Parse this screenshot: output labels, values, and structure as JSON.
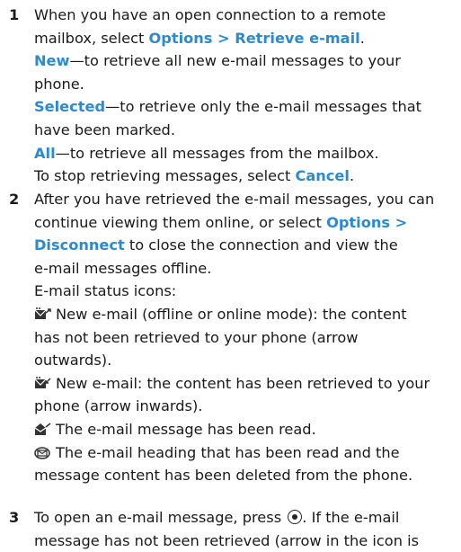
{
  "step1": {
    "number": "1",
    "line1": "When you have an open connection to a remote",
    "line2_text": "mailbox, select ",
    "line2_kw": "Options > Retrieve e-mail",
    "line2_end": ".",
    "new_kw": "New",
    "new_text": "—to retrieve all new e-mail messages to your",
    "new_text2": "phone.",
    "selected_kw": "Selected",
    "selected_text": "—to retrieve only the e-mail messages that",
    "selected_text2": "have been marked.",
    "all_kw": "All",
    "all_text": "—to retrieve all messages from the mailbox.",
    "stop_text": "To stop retrieving messages, select ",
    "stop_kw": "Cancel",
    "stop_end": "."
  },
  "step2": {
    "number": "2",
    "line1": "After you have retrieved the e-mail messages, you can",
    "line2_text": "continue viewing them online, or select ",
    "line2_kw": "Options >",
    "line3_kw": "Disconnect",
    "line3_text": " to close the connection and view the",
    "line4": "e-mail messages offline.",
    "icons_heading": "E-mail status icons:",
    "icons": [
      {
        "icon": "new-email-not-retrieved-icon",
        "text1": "New e-mail (offline or online mode): the content",
        "text2": "has not been retrieved to your phone (arrow",
        "text3": "outwards)."
      },
      {
        "icon": "new-email-retrieved-icon",
        "text1": "New e-mail: the content has been retrieved to your",
        "text2": "phone (arrow inwards)."
      },
      {
        "icon": "read-email-icon",
        "text1": "The e-mail message has been read."
      },
      {
        "icon": "deleted-content-icon",
        "text1": "The e-mail heading that has been read and the",
        "text2": "message content has been deleted from the phone."
      }
    ]
  },
  "step3": {
    "number": "3",
    "line1_a": "To open an e-mail message, press ",
    "line1_key": "selection-key-icon",
    "line1_b": ". If the e-mail",
    "line2": "message has not been retrieved (arrow in the icon is"
  },
  "colors": {
    "keyword": "#2a8ad4",
    "text": "#1a1a1a"
  }
}
